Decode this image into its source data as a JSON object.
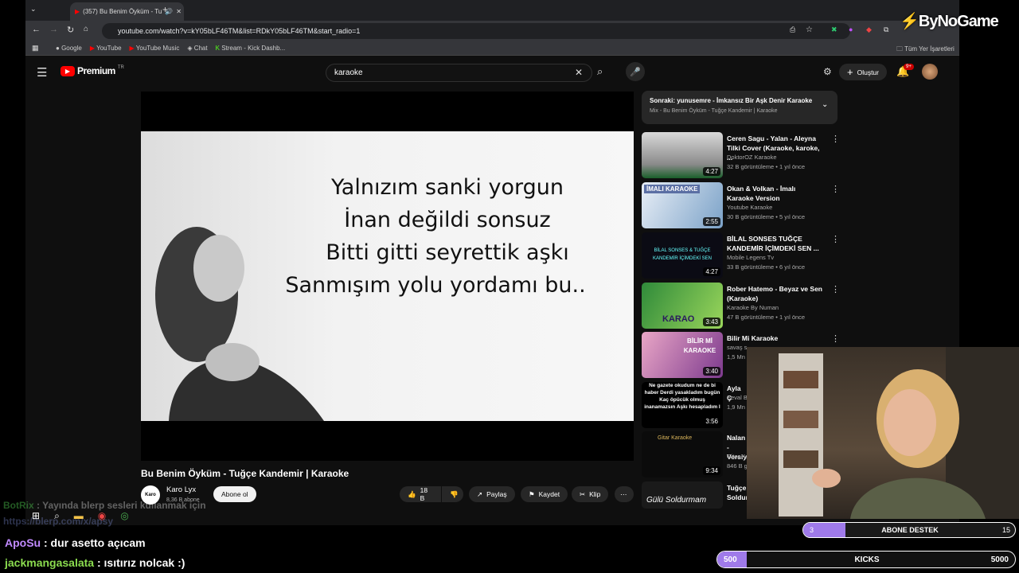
{
  "browser": {
    "tab_title": "(357) Bu Benim Öyküm - Tu",
    "url": "youtube.com/watch?v=kY05bLF46TM&list=RDkY05bLF46TM&start_radio=1",
    "bookmarks": [
      "Google",
      "YouTube",
      "YouTube Music",
      "Chat",
      "Stream - Kick Dashb..."
    ],
    "all_bookmarks": "Tüm Yer İşaretleri"
  },
  "overlay_logo": "ByNoGame",
  "youtube": {
    "logo": "Premium",
    "logo_sup": "TR",
    "search_value": "karaoke",
    "create_label": "Oluştur",
    "notif_badge": "9+",
    "lyrics": [
      "Yalnızım sanki yorgun",
      "İnan değildi sonsuz",
      "Bitti gitti seyrettik aşkı",
      "Sanmışım yolu yordamı bu.."
    ],
    "video_title": "Bu Benim Öyküm - Tuğçe Kandemir | Karaoke",
    "channel": "Karo Lyx",
    "channel_subs": "8,36 B abone",
    "subscribe": "Abone ol",
    "likes": "18 B",
    "share": "Paylaş",
    "save": "Kaydet",
    "clip": "Klip",
    "next_title": "Sonraki: yunusemre - İmkansız Bir Aşk Denir Karaoke",
    "next_sub": "Mix - Bu Benim Öyküm - Tuğçe Kandemir | Karaoke",
    "playlist": [
      {
        "title": "Ceren Sagu - Yalan - Aleyna Tilki Cover (Karaoke, karoke, ...",
        "channel": "DoktorOZ Karaoke",
        "meta": "32 B görüntüleme • 1 yıl önce",
        "duration": "4:27"
      },
      {
        "title": "Okan & Volkan - İmalı Karaoke Version",
        "channel": "Youtube Karaoke",
        "meta": "30 B görüntüleme • 5 yıl önce",
        "duration": "2:55"
      },
      {
        "title": "BİLAL SONSES TUĞÇE KANDEMİR İÇİMDEKİ SEN ...",
        "channel": "Mobile Legens Tv",
        "meta": "33 B görüntüleme • 6 yıl önce",
        "duration": "4:27"
      },
      {
        "title": "Rober Hatemo - Beyaz ve Sen (Karaoke)",
        "channel": "Karaoke By Numan",
        "meta": "47 B görüntüleme • 1 yıl önce",
        "duration": "3:43"
      },
      {
        "title": "Bilir Mi Karaoke",
        "channel": "savaş so",
        "meta": "1,5 Mn g",
        "duration": "3:40"
      },
      {
        "title": "Ayla Ç",
        "channel": "Seval Ba",
        "meta": "1,9 Mn g",
        "duration": "3:56"
      },
      {
        "title": "Nalan - Versiy",
        "channel": "Gitar Kar",
        "meta": "846 B g",
        "duration": "9:34"
      },
      {
        "title": "Tuğçe Soldur",
        "channel": "",
        "meta": "",
        "duration": ""
      }
    ],
    "thumb_texts": [
      "İMALI KARAOKE",
      "BİLAL SONSES & TUĞÇE KANDEMİR İÇİMDEKİ SEN",
      "KARAO",
      "BİLİR Mİ KARAOKE",
      "Ne gazete okudum ne de bi haber Derdi yasakladım bugün Kaç öpücük olmuş inanamazsın Aşkı hesapladım l",
      "Gitar Karaoke",
      "Gülü Soldurmam"
    ]
  },
  "stream": {
    "chat": [
      {
        "user": "BotRix",
        "msg": " : Yayında blerp sesleri kullanmak için"
      },
      {
        "user": "",
        "msg": "https://blerp.com/x/apsy"
      },
      {
        "user": "ApoSu",
        "msg": " : dur asetto açıcam"
      },
      {
        "user": "jackmangasalata",
        "msg": " : ısıtırız nolcak :)"
      }
    ],
    "goal1_label": "ABONE DESTEK",
    "goal1_current": "3",
    "goal1_target": "15",
    "goal1_fraction": 0.2,
    "goal2_label": "KICKS",
    "goal2_current": "500",
    "goal2_target": "5000",
    "goal2_fraction": 0.1
  },
  "colors": {
    "yt_bg": "#0f0f0f",
    "goal_purple": "#9f7aea",
    "chat_apo": "#c18aff",
    "chat_jack": "#8bdc4f"
  }
}
